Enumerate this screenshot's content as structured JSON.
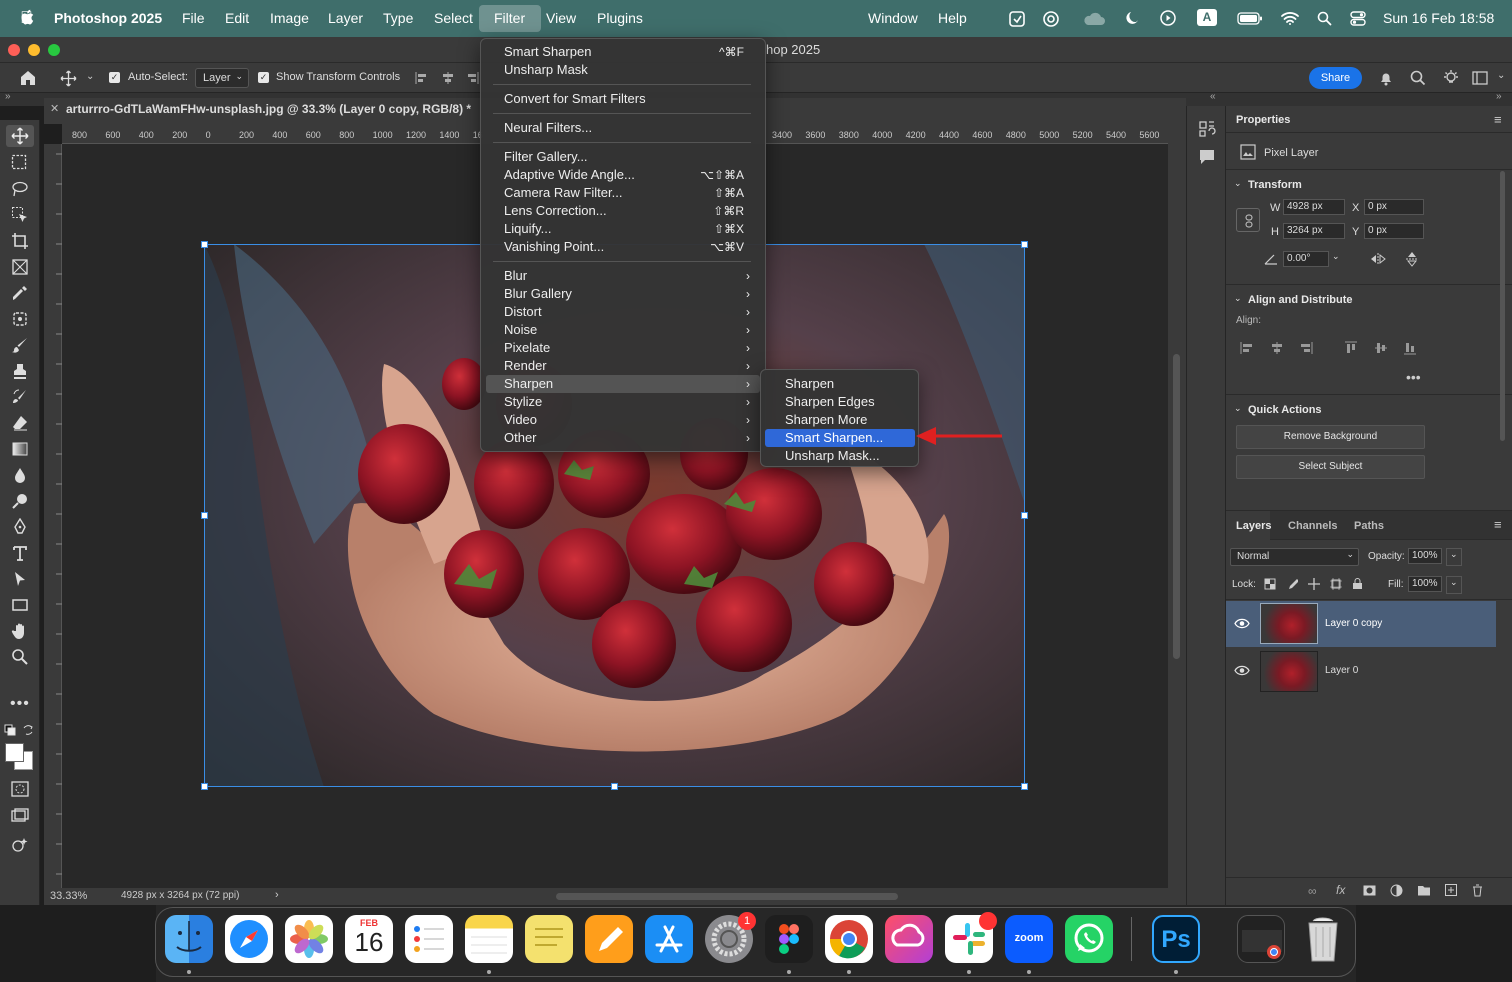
{
  "menubar": {
    "app_name": "Photoshop 2025",
    "items": [
      "File",
      "Edit",
      "Image",
      "Layer",
      "Type",
      "Select",
      "Filter",
      "View",
      "Plugins"
    ],
    "right_items": [
      "Window",
      "Help"
    ],
    "input_source": "A",
    "datetime": "Sun 16 Feb  18:58"
  },
  "window": {
    "title_partial": "hop 2025"
  },
  "options_bar": {
    "auto_select_label": "Auto-Select:",
    "auto_select_value": "Layer",
    "transform_controls_label": "Show Transform Controls",
    "share_label": "Share"
  },
  "document": {
    "tab_title": "arturrro-GdTLaWamFHw-unsplash.jpg @ 33.3% (Layer 0 copy, RGB/8) *",
    "zoom": "33.33%",
    "dimensions": "4928 px x 3264 px (72 ppi)",
    "ruler_ticks_left": [
      "800",
      "600",
      "400",
      "200",
      "0",
      "200",
      "400",
      "600",
      "800",
      "1000",
      "1200",
      "1400",
      "16"
    ],
    "ruler_ticks_right": [
      "3400",
      "3600",
      "3800",
      "4000",
      "4200",
      "4400",
      "4600",
      "4800",
      "5000",
      "5200",
      "5400",
      "5600"
    ]
  },
  "filter_menu": {
    "groups": [
      [
        {
          "label": "Smart Sharpen",
          "shortcut": "^⌘F"
        },
        {
          "label": "Unsharp Mask",
          "shortcut": ""
        }
      ],
      [
        {
          "label": "Convert for Smart Filters",
          "shortcut": ""
        }
      ],
      [
        {
          "label": "Neural Filters...",
          "shortcut": ""
        }
      ],
      [
        {
          "label": "Filter Gallery...",
          "shortcut": ""
        },
        {
          "label": "Adaptive Wide Angle...",
          "shortcut": "⌥⇧⌘A"
        },
        {
          "label": "Camera Raw Filter...",
          "shortcut": "⇧⌘A"
        },
        {
          "label": "Lens Correction...",
          "shortcut": "⇧⌘R"
        },
        {
          "label": "Liquify...",
          "shortcut": "⇧⌘X"
        },
        {
          "label": "Vanishing Point...",
          "shortcut": "⌥⌘V"
        }
      ],
      [
        {
          "label": "Blur",
          "shortcut": "›"
        },
        {
          "label": "Blur Gallery",
          "shortcut": "›"
        },
        {
          "label": "Distort",
          "shortcut": "›"
        },
        {
          "label": "Noise",
          "shortcut": "›"
        },
        {
          "label": "Pixelate",
          "shortcut": "›"
        },
        {
          "label": "Render",
          "shortcut": "›"
        },
        {
          "label": "Sharpen",
          "shortcut": "›"
        },
        {
          "label": "Stylize",
          "shortcut": "›"
        },
        {
          "label": "Video",
          "shortcut": "›"
        },
        {
          "label": "Other",
          "shortcut": "›"
        }
      ]
    ],
    "highlighted": "Sharpen"
  },
  "sharpen_submenu": {
    "items": [
      "Sharpen",
      "Sharpen Edges",
      "Sharpen More",
      "Smart Sharpen...",
      "Unsharp Mask..."
    ],
    "selected": "Smart Sharpen..."
  },
  "properties_panel": {
    "title": "Properties",
    "layer_type": "Pixel Layer",
    "transform_title": "Transform",
    "w_label": "W",
    "w_value": "4928 px",
    "h_label": "H",
    "h_value": "3264 px",
    "x_label": "X",
    "x_value": "0 px",
    "y_label": "Y",
    "y_value": "0 px",
    "angle_value": "0.00°",
    "align_title": "Align and Distribute",
    "align_label": "Align:",
    "quick_actions_title": "Quick Actions",
    "remove_bg_label": "Remove Background",
    "select_subject_label": "Select Subject"
  },
  "layers_panel": {
    "tabs": [
      "Layers",
      "Channels",
      "Paths"
    ],
    "blend_mode": "Normal",
    "opacity_label": "Opacity:",
    "opacity_value": "100%",
    "lock_label": "Lock:",
    "fill_label": "Fill:",
    "fill_value": "100%",
    "layers": [
      "Layer 0 copy",
      "Layer 0"
    ],
    "selected_layer": "Layer 0 copy"
  },
  "dock": {
    "calendar_month": "FEB",
    "calendar_day": "16",
    "zoom_label": "zoom",
    "ps_label": "Ps",
    "settings_badge": "1"
  },
  "colors": {
    "menubar": "#3f6e6b",
    "highlight": "#2f68d8",
    "annotation_arrow": "#e02020",
    "share_button": "#1a73e8"
  }
}
